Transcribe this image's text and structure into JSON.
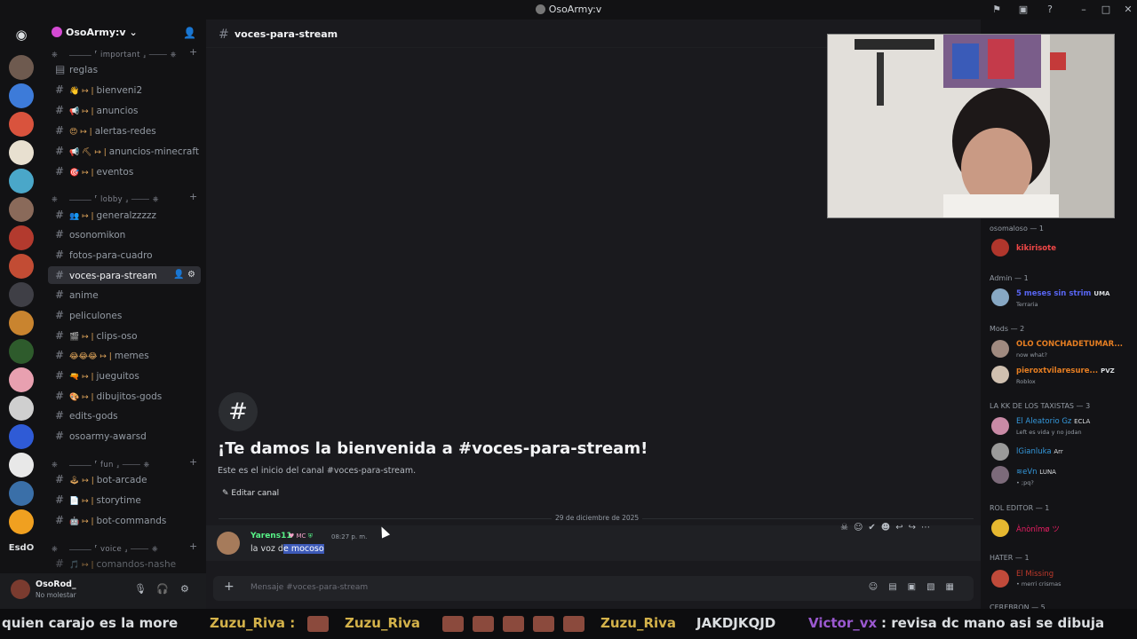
{
  "window": {
    "title": "OsoArmy:v"
  },
  "server": {
    "name": "OsoArmy:v"
  },
  "categories": {
    "important": "⎈ ⠀ ⸻ ⸢ important ⸥ ⸻ ⎈",
    "lobby": "⎈ ⠀ ⸻ ⸢ lobby ⸥ ⸻ ⎈",
    "fun": "⎈ ⠀ ⸻ ⸢ fun ⸥ ⸻ ⎈",
    "voice": "⎈ ⠀ ⸻ ⸢ voice ⸥ ⸻ ⎈"
  },
  "channels": [
    {
      "name": "reglas",
      "prefix": ""
    },
    {
      "name": "bienveni2",
      "prefix": "👋 ↦ |"
    },
    {
      "name": "anuncios",
      "prefix": "📢 ↦ |"
    },
    {
      "name": "alertas-redes",
      "prefix": "😍 ↦ |"
    },
    {
      "name": "anuncios-minecraft",
      "prefix": "📢 ⛏ ↦ |"
    },
    {
      "name": "eventos",
      "prefix": "🎯 ↦ |"
    },
    {
      "name": "generalzzzzz",
      "prefix": "👥 ↦ |"
    },
    {
      "name": "osonomikon",
      "prefix": ""
    },
    {
      "name": "fotos-para-cuadro",
      "prefix": ""
    },
    {
      "name": "voces-para-stream",
      "prefix": ""
    },
    {
      "name": "anime",
      "prefix": ""
    },
    {
      "name": "peliculones",
      "prefix": ""
    },
    {
      "name": "clips-oso",
      "prefix": "🎬 ↦ |"
    },
    {
      "name": "memes",
      "prefix": "😂😂😂 ↦ |"
    },
    {
      "name": "jueguitos",
      "prefix": "🔫 ↦ |"
    },
    {
      "name": "dibujitos-gods",
      "prefix": "🎨 ↦ |"
    },
    {
      "name": "edits-gods",
      "prefix": ""
    },
    {
      "name": "osoarmy-awarsd",
      "prefix": ""
    },
    {
      "name": "bot-arcade",
      "prefix": "🕹 ↦ |"
    },
    {
      "name": "storytime",
      "prefix": "📄 ↦ |"
    },
    {
      "name": "bot-commands",
      "prefix": "🤖 ↦ |"
    },
    {
      "name": "comandos-nashe",
      "prefix": "🎵 ↦ |"
    }
  ],
  "current_channel": "voces-para-stream",
  "header": {
    "channel": "voces-para-stream"
  },
  "welcome": {
    "title": "¡Te damos la bienvenida a #voces-para-stream!",
    "subtitle": "Este es el inicio del canal #voces-para-stream.",
    "edit_label": "Editar canal"
  },
  "date_divider": "29 de diciembre de 2025",
  "message": {
    "author": "Yarens11",
    "badge": "MC",
    "time": "08:27 p. m.",
    "text_before": "la voz d",
    "text_highlight": "e mocoso"
  },
  "composer": {
    "placeholder": "Mensaje #voces-para-stream"
  },
  "user": {
    "name": "OsoRod_",
    "status": "No molestar"
  },
  "members": [
    {
      "group": "osomaloso — 1",
      "name": "kikirisote",
      "tag": "",
      "activity": "",
      "color": "#f04747"
    },
    {
      "group": "Admin — 1",
      "name": "5 meses sin strim",
      "tag": "UMA",
      "activity": "Terraria",
      "color": "#5865f2"
    },
    {
      "group": "Mods — 2",
      "name": "OLO CONCHADETUMAR...",
      "tag": "",
      "activity": "now what?",
      "color": "#e67e22"
    },
    {
      "group": "",
      "name": "pieroxtvilaresure...",
      "tag": "PVZ",
      "activity": "Roblox",
      "color": "#e67e22"
    },
    {
      "group": "LA KK DE LOS TAXISTAS — 3",
      "name": "El Aleatorio Gz",
      "tag": "ECLA",
      "activity": "Left es vida y no jodan",
      "color": "#3498db"
    },
    {
      "group": "",
      "name": "lGianluka",
      "tag": "Arr",
      "activity": "",
      "color": "#3498db"
    },
    {
      "group": "",
      "name": "≋eVn",
      "tag": "LUNA",
      "activity": "• ;pq?",
      "color": "#3498db"
    },
    {
      "group": "ROL EDITOR — 1",
      "name": "Ànònîmø ツ",
      "tag": "",
      "activity": "",
      "color": "#e91e63"
    },
    {
      "group": "HATER — 1",
      "name": "El Missing",
      "tag": "",
      "activity": "• merri crismas",
      "color": "#c0392b"
    },
    {
      "group": "CEREBRON — 5",
      "name": "",
      "tag": "",
      "activity": "",
      "color": "#dbdee1"
    }
  ],
  "ticker": [
    {
      "text": "quien carajo es la more",
      "color": "#ffffff"
    },
    {
      "text": "Zuzu_Riva :",
      "color": "#d4b24a"
    },
    {
      "text": "Zuzu_Riva",
      "color": "#d4b24a"
    },
    {
      "text": "Zuzu_Riva",
      "color": "#d4b24a"
    },
    {
      "text": "JAKDJKQJD",
      "color": "#ffffff"
    },
    {
      "text": "Victor_vx",
      "color": "#9b59d0"
    },
    {
      "text": ": revisa dc mano asi se dibuja",
      "color": "#ffffff"
    }
  ]
}
